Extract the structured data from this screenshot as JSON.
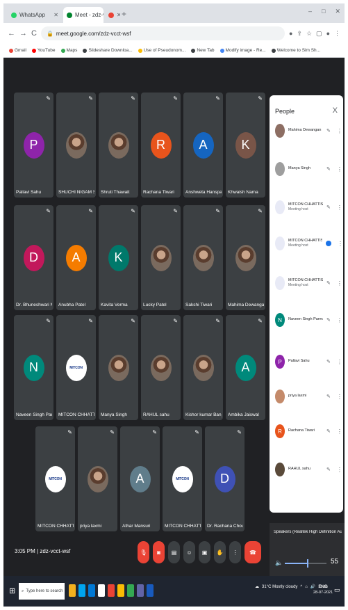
{
  "browser": {
    "tabs": [
      {
        "title": "WhatsApp",
        "favicon_color": "#25d366"
      },
      {
        "title": "Meet - zdz-vcct-wsf",
        "favicon_color": "#00832d"
      },
      {
        "title": "",
        "favicon_color": "#ea4335"
      }
    ],
    "new_tab": "+",
    "window_controls": [
      "–",
      "□",
      "✕"
    ],
    "url": "meet.google.com/zdz-vcct-wsf",
    "nav": {
      "back": "←",
      "forward": "→",
      "reload": "C"
    },
    "bookmarks": [
      {
        "label": "Gmail",
        "color": "#ea4335"
      },
      {
        "label": "YouTube",
        "color": "#ff0000"
      },
      {
        "label": "Maps",
        "color": "#34a853"
      },
      {
        "label": "Slideshare Downloa...",
        "color": "#3c4043"
      },
      {
        "label": "Use of Pseudonom...",
        "color": "#fbbc04"
      },
      {
        "label": "New Tab",
        "color": "#3c4043"
      },
      {
        "label": "Modify image - Re...",
        "color": "#4285f4"
      },
      {
        "label": "Welcome to Sim Sh...",
        "color": "#3c4043"
      }
    ]
  },
  "tiles": [
    {
      "name": "Pallavi Sahu",
      "initial": "P",
      "color": "#8e24aa",
      "kind": "avatar"
    },
    {
      "name": "SHUCHI NIGAM SRIV...",
      "initial": "",
      "color": "#9e9e9e",
      "kind": "photo"
    },
    {
      "name": "Shruti Thawait",
      "initial": "",
      "color": "#2e7d7d",
      "kind": "photo"
    },
    {
      "name": "Rachana Tiwari",
      "initial": "R",
      "color": "#e8541c",
      "kind": "avatar"
    },
    {
      "name": "Anshweta Hanspal",
      "initial": "A",
      "color": "#1565c0",
      "kind": "avatar"
    },
    {
      "name": "Khwaish Nama",
      "initial": "K",
      "color": "#795548",
      "kind": "avatar"
    },
    {
      "name": "Dr. Bhuneshwari Nayak",
      "initial": "D",
      "color": "#c2185b",
      "kind": "avatar"
    },
    {
      "name": "Anubha Patel",
      "initial": "A",
      "color": "#f57c00",
      "kind": "avatar"
    },
    {
      "name": "Kavita Verma",
      "initial": "K",
      "color": "#00796b",
      "kind": "avatar"
    },
    {
      "name": "Lucky Patel",
      "initial": "",
      "color": "#5d8aa8",
      "kind": "photo"
    },
    {
      "name": "Sakshi Tiwari",
      "initial": "",
      "color": "#6d6d6d",
      "kind": "photo"
    },
    {
      "name": "Mahima Dewangan",
      "initial": "",
      "color": "#8d6e63",
      "kind": "photo"
    },
    {
      "name": "Naveen Singh Parmar",
      "initial": "N",
      "color": "#00897b",
      "kind": "avatar"
    },
    {
      "name": "MITCON CHHATTISG...",
      "initial": "",
      "color": "#ffffff",
      "kind": "mitcon"
    },
    {
      "name": "Manya Singh",
      "initial": "",
      "color": "#9e9e9e",
      "kind": "photo"
    },
    {
      "name": "RAHUL sahu",
      "initial": "",
      "color": "#5a4a3a",
      "kind": "photo"
    },
    {
      "name": "Kishor kumar Banjare",
      "initial": "",
      "color": "#7a6a5a",
      "kind": "photo"
    },
    {
      "name": "Ambika Jaiswal",
      "initial": "A",
      "color": "#00897b",
      "kind": "avatar"
    },
    {
      "name": "MITCON CHHATTISG...",
      "initial": "",
      "color": "#ffffff",
      "kind": "mitcon"
    },
    {
      "name": "priya laxmi",
      "initial": "",
      "color": "#c48a6a",
      "kind": "photo"
    },
    {
      "name": "Athar Mansuri",
      "initial": "A",
      "color": "#607d8b",
      "kind": "avatar"
    },
    {
      "name": "MITCON CHHATTISG...",
      "initial": "",
      "color": "#ffffff",
      "kind": "mitcon"
    },
    {
      "name": "Dr. Rachana Choudhary",
      "initial": "D",
      "color": "#3f51b5",
      "kind": "avatar"
    }
  ],
  "mitcon_logo": "MITCON",
  "meeting": {
    "time": "3:05 PM",
    "separator": "|",
    "code": "zdz-vcct-wsf"
  },
  "controls": [
    "mic-off",
    "cam-off",
    "captions",
    "present",
    "raise-hand",
    "more",
    "end-call"
  ],
  "people_panel": {
    "title": "People",
    "close": "X",
    "participants": [
      {
        "name": "Mahima Dewangan",
        "sub": "",
        "color": "#8d6e63",
        "initial": ""
      },
      {
        "name": "Manya Singh",
        "sub": "",
        "color": "#9e9e9e",
        "initial": ""
      },
      {
        "name": "MITCON CHHATTISGARH",
        "sub": "Meeting host",
        "color": "#ffffff",
        "initial": ""
      },
      {
        "name": "MITCON CHHATTISGARH",
        "sub": "Meeting host",
        "color": "#ffffff",
        "initial": ""
      },
      {
        "name": "MITCON CHHATTISGARH",
        "sub": "Meeting host",
        "color": "#ffffff",
        "initial": ""
      },
      {
        "name": "Naveen Singh Parmar",
        "sub": "",
        "color": "#00897b",
        "initial": "N"
      },
      {
        "name": "Pallavi Sahu",
        "sub": "",
        "color": "#8e24aa",
        "initial": "P"
      },
      {
        "name": "priya laxmi",
        "sub": "",
        "color": "#c48a6a",
        "initial": ""
      },
      {
        "name": "Rachana Tiwari",
        "sub": "",
        "color": "#e8541c",
        "initial": "R"
      },
      {
        "name": "RAHUL sahu",
        "sub": "",
        "color": "#5a4a3a",
        "initial": ""
      }
    ]
  },
  "speaker": {
    "label": "Speakers (Realtek High Definition Audio)",
    "volume": 55,
    "volume_text": "55"
  },
  "taskbar": {
    "search_placeholder": "Type here to search",
    "weather": "31°C Mostly cloudy",
    "lang": "ENG",
    "time": "15:05",
    "date": "28-07-2021",
    "apps": [
      "#f2b01e",
      "#00a4ef",
      "#0078d4",
      "#ffffff",
      "#ea4335",
      "#fbbc04",
      "#34a853",
      "#6264a7",
      "#185abd"
    ]
  }
}
